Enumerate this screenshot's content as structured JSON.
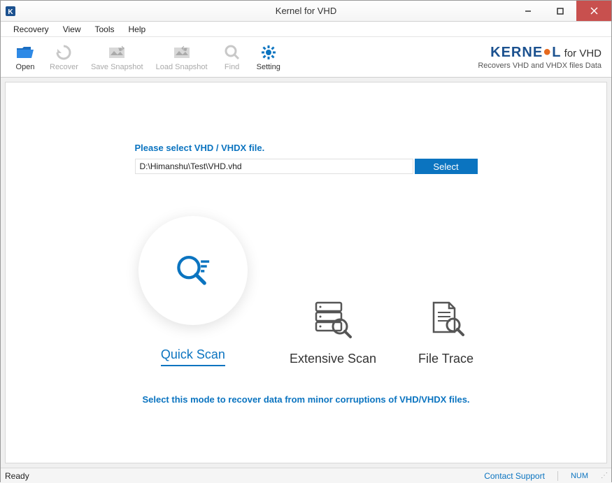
{
  "window": {
    "title": "Kernel for VHD"
  },
  "menu": {
    "items": [
      {
        "label": "Recovery"
      },
      {
        "label": "View"
      },
      {
        "label": "Tools"
      },
      {
        "label": "Help"
      }
    ]
  },
  "toolbar": {
    "buttons": [
      {
        "label": "Open",
        "icon": "folder-open-icon",
        "enabled": true
      },
      {
        "label": "Recover",
        "icon": "recover-icon",
        "enabled": false
      },
      {
        "label": "Save Snapshot",
        "icon": "save-snapshot-icon",
        "enabled": false
      },
      {
        "label": "Load Snapshot",
        "icon": "load-snapshot-icon",
        "enabled": false
      },
      {
        "label": "Find",
        "icon": "find-icon",
        "enabled": false
      },
      {
        "label": "Setting",
        "icon": "setting-icon",
        "enabled": true
      }
    ],
    "brand": {
      "name": "KERNEL",
      "suffix": " for VHD",
      "tagline": "Recovers VHD and VHDX files Data"
    }
  },
  "main": {
    "prompt": "Please select VHD / VHDX file.",
    "file_path": "D:\\Himanshu\\Test\\VHD.vhd",
    "select_label": "Select",
    "modes": [
      {
        "label": "Quick Scan",
        "active": true
      },
      {
        "label": "Extensive Scan",
        "active": false
      },
      {
        "label": "File Trace",
        "active": false
      }
    ],
    "mode_description": "Select this mode to recover data from minor corruptions of VHD/VHDX files."
  },
  "status": {
    "left": "Ready",
    "contact": "Contact Support",
    "indicator": "NUM"
  }
}
